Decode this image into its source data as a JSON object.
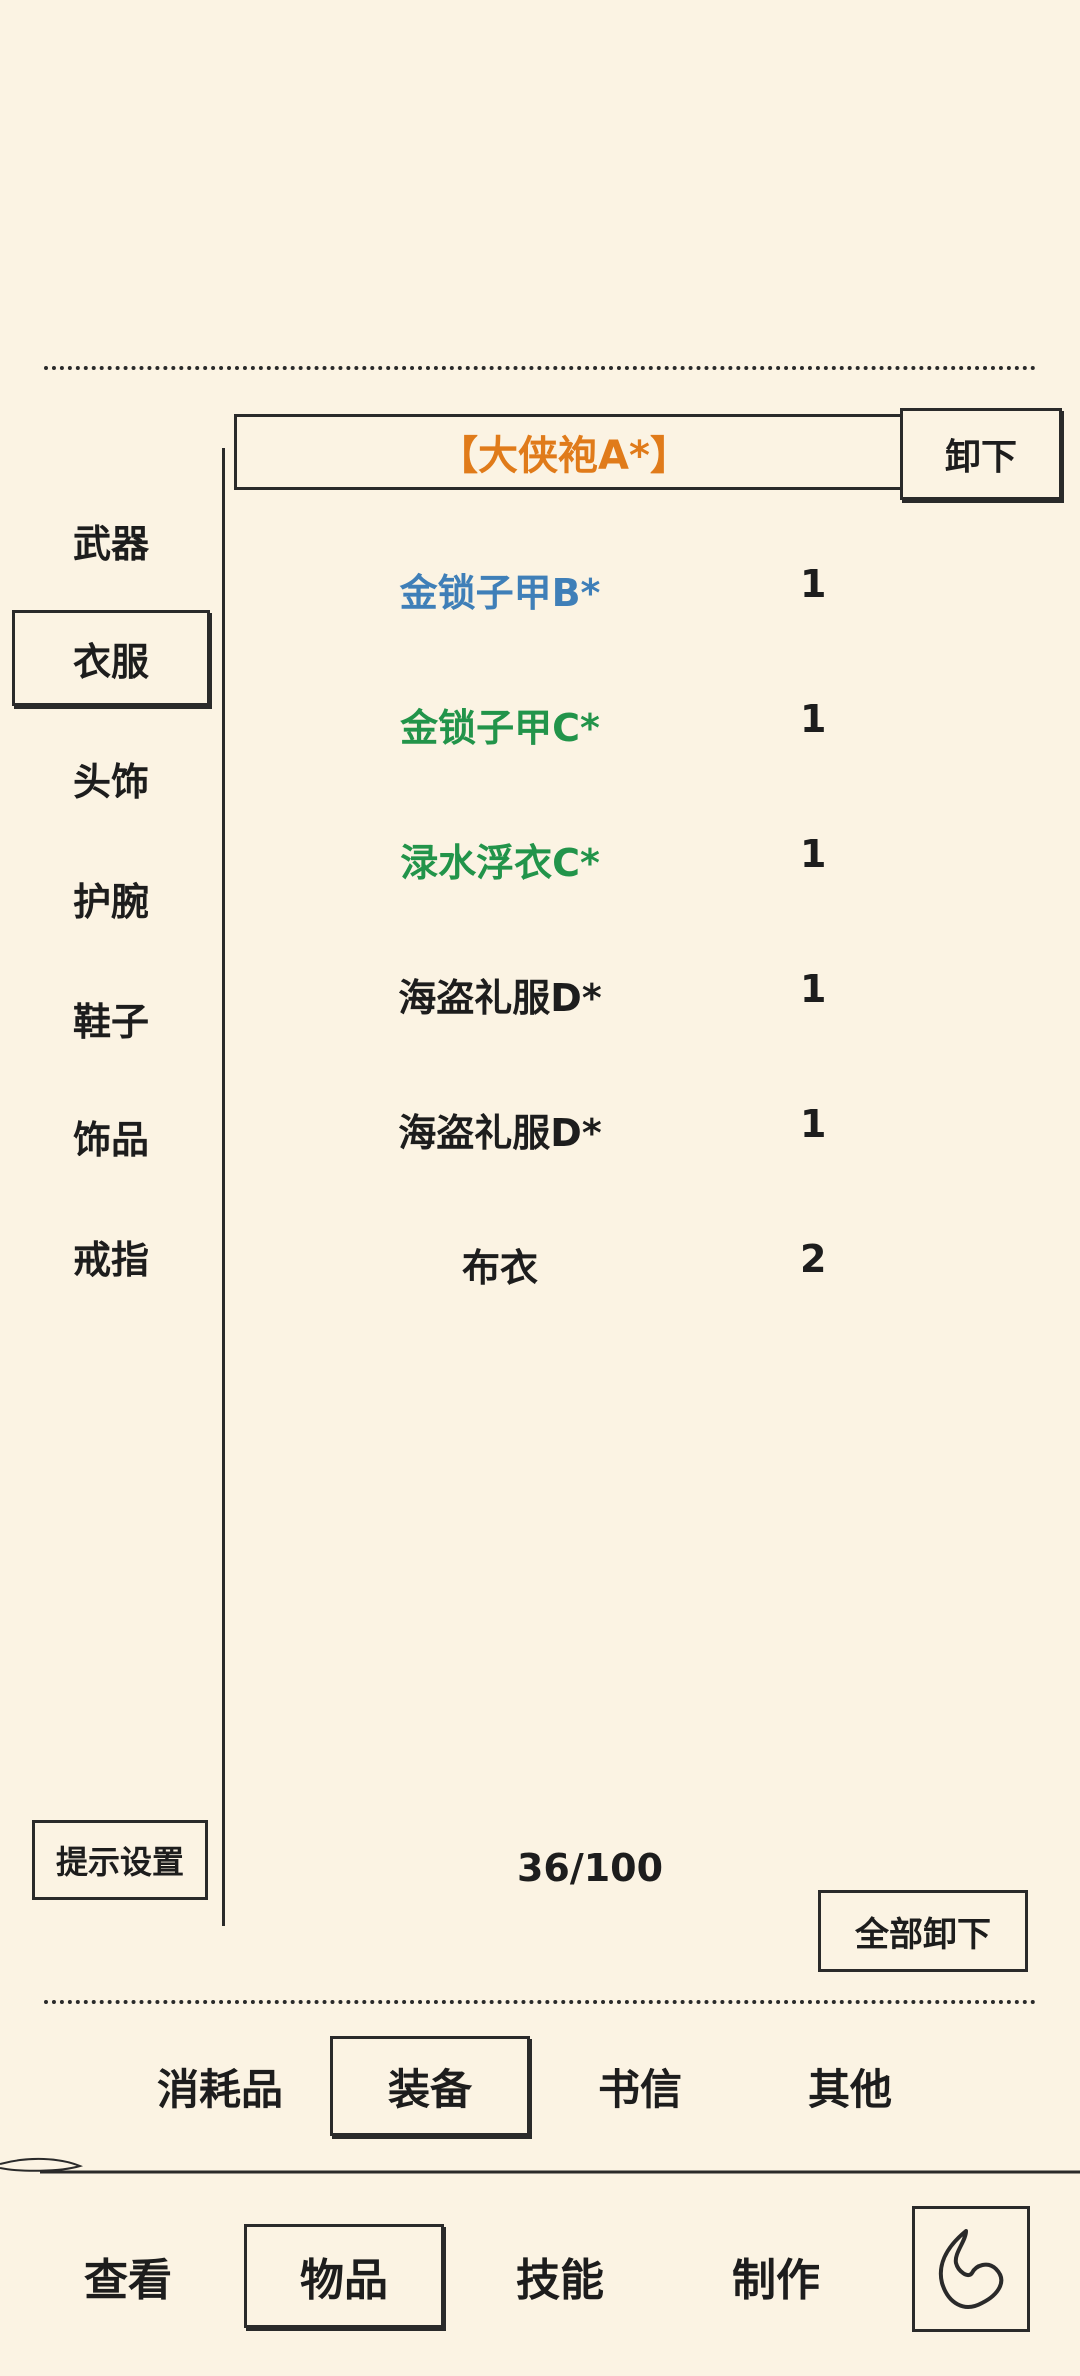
{
  "categories": [
    {
      "label": "武器",
      "selected": false
    },
    {
      "label": "衣服",
      "selected": true
    },
    {
      "label": "头饰",
      "selected": false
    },
    {
      "label": "护腕",
      "selected": false
    },
    {
      "label": "鞋子",
      "selected": false
    },
    {
      "label": "饰品",
      "selected": false
    },
    {
      "label": "戒指",
      "selected": false
    }
  ],
  "equipped": {
    "name": "【大侠袍A*】",
    "color": "#e07b1a",
    "unequip_label": "卸下"
  },
  "items": [
    {
      "name": "金锁子甲B*",
      "qty": "1",
      "color": "#3f7fb8"
    },
    {
      "name": "金锁子甲C*",
      "qty": "1",
      "color": "#22944a"
    },
    {
      "name": "渌水浮衣C*",
      "qty": "1",
      "color": "#22944a"
    },
    {
      "name": "海盗礼服D*",
      "qty": "1",
      "color": "#1d1d1d"
    },
    {
      "name": "海盗礼服D*",
      "qty": "1",
      "color": "#1d1d1d"
    },
    {
      "name": "布衣",
      "qty": "2",
      "color": "#1d1d1d"
    }
  ],
  "footer": {
    "hint_settings_label": "提示设置",
    "capacity": "36/100",
    "unequip_all_label": "全部卸下"
  },
  "subtabs": [
    {
      "label": "消耗品",
      "selected": false
    },
    {
      "label": "装备",
      "selected": true
    },
    {
      "label": "书信",
      "selected": false
    },
    {
      "label": "其他",
      "selected": false
    }
  ],
  "main_tabs": [
    {
      "label": "查看",
      "selected": false
    },
    {
      "label": "物品",
      "selected": true
    },
    {
      "label": "技能",
      "selected": false
    },
    {
      "label": "制作",
      "selected": false
    }
  ],
  "back_icon": "back-arrow-icon"
}
